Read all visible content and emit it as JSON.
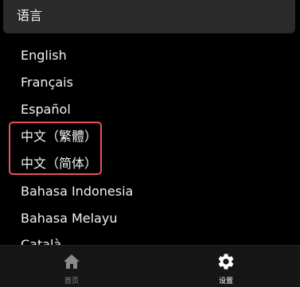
{
  "header": {
    "title": "语言"
  },
  "languages": [
    "English",
    "Français",
    "Español",
    "中文（繁體）",
    "中文（简体）",
    "Bahasa Indonesia",
    "Bahasa Melayu",
    "Català"
  ],
  "highlight_color": "#e8505b",
  "bottom_nav": {
    "home": {
      "label": "首页",
      "icon": "home-icon",
      "active": false
    },
    "settings": {
      "label": "设置",
      "icon": "gear-icon",
      "active": true
    }
  },
  "colors": {
    "background": "#000000",
    "header_bg": "#2b2b2b",
    "text": "#f2f2f2",
    "nav_bg": "#161616",
    "nav_inactive": "#8a8a8a",
    "nav_active": "#ffffff"
  }
}
